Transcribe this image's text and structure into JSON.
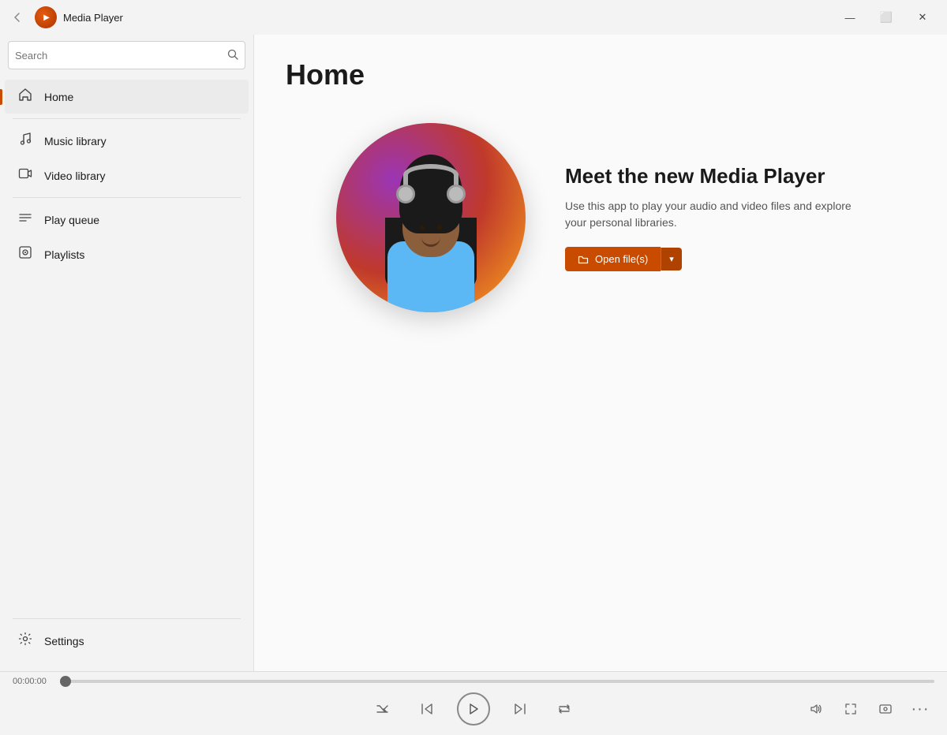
{
  "titleBar": {
    "appName": "Media Player",
    "controls": {
      "minimize": "—",
      "maximize": "⬜",
      "close": "✕"
    }
  },
  "sidebar": {
    "searchPlaceholder": "Search",
    "navItems": [
      {
        "id": "home",
        "label": "Home",
        "icon": "🏠",
        "active": true
      },
      {
        "id": "music-library",
        "label": "Music library",
        "icon": "🎵"
      },
      {
        "id": "video-library",
        "label": "Video library",
        "icon": "🎬"
      },
      {
        "id": "play-queue",
        "label": "Play queue",
        "icon": "☰"
      },
      {
        "id": "playlists",
        "label": "Playlists",
        "icon": "⊡"
      }
    ],
    "bottomItems": [
      {
        "id": "settings",
        "label": "Settings",
        "icon": "⚙"
      }
    ]
  },
  "main": {
    "pageTitle": "Home",
    "hero": {
      "heading": "Meet the new Media Player",
      "description": "Use this app to play your audio and video files and explore your personal libraries.",
      "openFilesLabel": "Open file(s)",
      "dropdownArrow": "▾"
    }
  },
  "player": {
    "currentTime": "00:00:00",
    "controls": {
      "shuffle": "⇄",
      "previous": "⏮",
      "play": "▶",
      "next": "⏭",
      "repeat": "⇌",
      "volume": "🔊",
      "fullscreen": "⤢",
      "cast": "⊡",
      "more": "···"
    }
  }
}
